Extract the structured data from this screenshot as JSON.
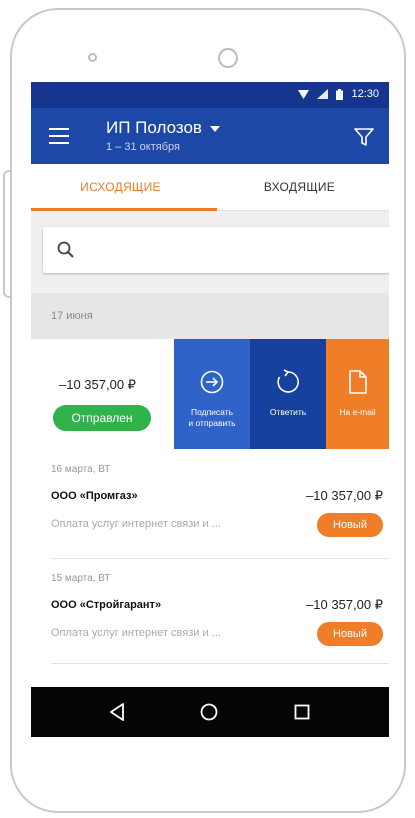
{
  "statusbar": {
    "time": "12:30"
  },
  "appbar": {
    "title": "ИП Полозов",
    "subtitle": "1 – 31 октября"
  },
  "tabs": {
    "outgoing": "ИСХОДЯЩИЕ",
    "incoming": "ВХОДЯЩИЕ"
  },
  "search": {
    "placeholder": ""
  },
  "group": {
    "date": "17 июня"
  },
  "swipe_item": {
    "amount": "–10 357,00 ₽",
    "status": "Отправлен",
    "actions": {
      "sign_line1": "Подписать",
      "sign_line2": "и отправить",
      "reply": "Ответить",
      "email": "На e-mail"
    }
  },
  "documents": [
    {
      "date": "16 марта, ВТ",
      "company": "ООО «Промгаз»",
      "amount": "–10 357,00 ₽",
      "description": "Оплата услуг интернет связи и ...",
      "badge": "Новый"
    },
    {
      "date": "15 марта, ВТ",
      "company": "ООО «Стройгарант»",
      "amount": "–10 357,00 ₽",
      "description": "Оплата услуг интернет связи и ...",
      "badge": "Новый"
    }
  ],
  "colors": {
    "primary": "#1e48a8",
    "statusbar": "#15358f",
    "accent": "#ee7b23",
    "success": "#2fb34a"
  }
}
